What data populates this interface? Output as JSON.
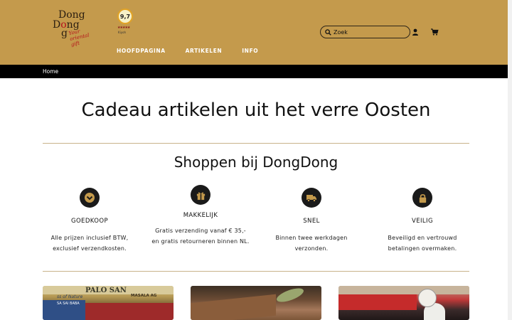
{
  "header": {
    "logo": {
      "line1": "Dong",
      "line2_a": "D",
      "line2_b": "o",
      "line2_c": "ng",
      "line3": "g",
      "tagline": "Your oriental gift"
    },
    "rating_badge": {
      "score": "9,7",
      "stars": "★★★★★",
      "caption": "Kiyoh"
    },
    "nav": [
      {
        "label": "HOOFDPAGINA"
      },
      {
        "label": "ARTIKELEN"
      },
      {
        "label": "INFO"
      }
    ],
    "search": {
      "placeholder": "Zoek",
      "value": ""
    },
    "icons": {
      "search": "search-icon",
      "user": "user-icon",
      "cart": "cart-icon"
    }
  },
  "breadcrumb": {
    "home": "Home"
  },
  "main": {
    "hero_title": "Cadeau artikelen uit het verre Oosten",
    "section_title": "Shoppen bij DongDong",
    "features": [
      {
        "icon": "chevron-down-circle-icon",
        "title": "GOEDKOOP",
        "text": "Alle prijzen inclusief BTW, exclusief verzendkosten."
      },
      {
        "icon": "gift-icon",
        "title": "MAKKELIJK",
        "text": "Gratis verzending vanaf € 35,- en gratis retourneren binnen NL."
      },
      {
        "icon": "truck-icon",
        "title": "SNEL",
        "text": "Binnen twee werkdagen verzonden."
      },
      {
        "icon": "lock-icon",
        "title": "VEILIG",
        "text": "Beveiligd en vertrouwd betalingen overmaken."
      }
    ],
    "thumbnails": {
      "t1": {
        "top_text": "PALO SAN",
        "nature": "ss of Nature",
        "masala": "MASALA AG",
        "sub": "SA",
        "bottom": "SA SAI BABA"
      }
    }
  },
  "colors": {
    "header_bg": "#c49a4c",
    "breadcrumb_bg": "#000000",
    "divider": "#c9b38a"
  }
}
